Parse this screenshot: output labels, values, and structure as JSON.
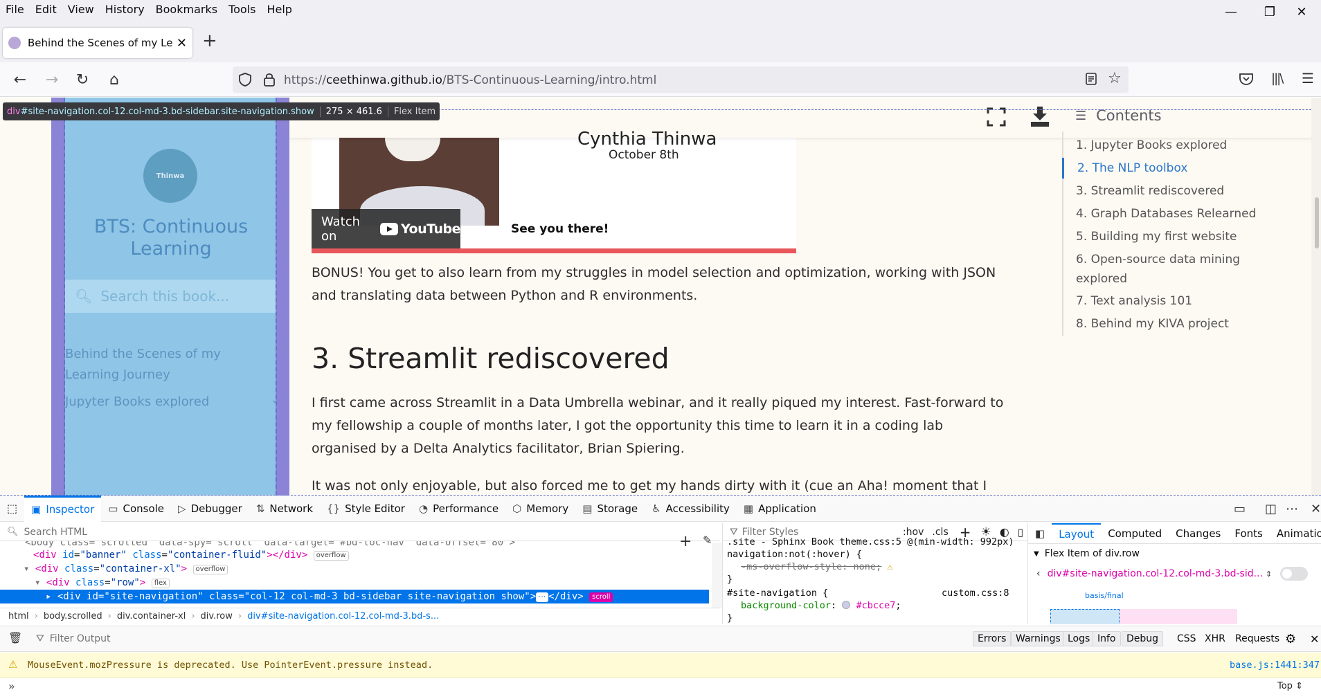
{
  "menubar": [
    "File",
    "Edit",
    "View",
    "History",
    "Bookmarks",
    "Tools",
    "Help"
  ],
  "tab": {
    "title": "Behind the Scenes of my Learning Journey"
  },
  "url": {
    "prefix": "https://",
    "host": "ceethinwa.github.io",
    "path": "/BTS-Continuous-Learning/intro.html"
  },
  "tooltip": {
    "tag": "div",
    "selector": "#site-navigation.col-12.col-md-3.bd-sidebar.site-navigation.show",
    "dimensions": "275 × 461.6",
    "kind": "Flex Item"
  },
  "sidebar": {
    "logo_text": "Thinwa",
    "title": "BTS: Continuous Learning",
    "search_placeholder": "Search this book...",
    "links": [
      "Behind the Scenes of my Learning Journey",
      "Jupyter Books explored"
    ]
  },
  "video": {
    "name": "Cynthia Thinwa",
    "date": "October 8th",
    "see_you": "See you there!",
    "watch_on": "Watch on",
    "youtube": "YouTube"
  },
  "article": {
    "bonus": "BONUS! You get to also learn from my struggles in model selection and optimization, working with JSON and translating data between Python and R environments.",
    "heading": "3. Streamlit rediscovered",
    "p1": "I first came across Streamlit in a Data Umbrella webinar, and it really piqued my interest. Fast-forward to my fellowship a couple of months later, I got the opportunity this time to learn it in a coding lab organised by a Delta Analytics facilitator, Brian Spiering.",
    "p2": "It was not only enjoyable, but also forced me to get my hands dirty with it (cue an Aha! moment that I"
  },
  "toc": {
    "title": "Contents",
    "items": [
      "1. Jupyter Books explored",
      "2. The NLP toolbox",
      "3. Streamlit rediscovered",
      "4. Graph Databases Relearned",
      "5. Building my first website",
      "6. Open-source data mining explored",
      "7. Text analysis 101",
      "8. Behind my KIVA project"
    ],
    "active_index": 1
  },
  "devtools": {
    "tabs": [
      "Inspector",
      "Console",
      "Debugger",
      "Network",
      "Style Editor",
      "Performance",
      "Memory",
      "Storage",
      "Accessibility",
      "Application"
    ],
    "active_tab": "Inspector",
    "search_html_placeholder": "Search HTML",
    "markup": {
      "line0": "<body class=\"scrolled\" data-spy=\"scroll\" data-target=\"#bd-toc-nav\" data-offset=\"80\">",
      "banner": {
        "tag": "div",
        "id": "banner",
        "class": "container-fluid",
        "badge": "overflow"
      },
      "container": {
        "tag": "div",
        "class": "container-xl",
        "badge": "overflow"
      },
      "row": {
        "tag": "div",
        "class": "row",
        "badge": "flex"
      },
      "selected": {
        "tag": "div",
        "id": "site-navigation",
        "class": "col-12 col-md-3 bd-sidebar site-navigation show",
        "badge": "scroll"
      }
    },
    "breadcrumbs": [
      "html",
      "body.scrolled",
      "div.container-xl",
      "div.row",
      "div#site-navigation.col-12.col-md-3.bd-s..."
    ],
    "styles": {
      "filter_placeholder": "Filter Styles",
      "hov": ":hov",
      "cls": ".cls",
      "rule1_sel_a": ".site - Sphinx Book theme.css:5 @(min-width: 992px)",
      "rule1_sel_b": "navigation:not(:hover) {",
      "rule1_prop": "-ms-overflow-style: none;",
      "rule2_sel": "#site-navigation {",
      "rule2_src": "custom.css:8",
      "rule2_prop": "background-color",
      "rule2_val": "#cbcce7",
      "close": "}"
    },
    "layout_tabs": [
      "Layout",
      "Computed",
      "Changes",
      "Fonts",
      "Animations"
    ],
    "flex_item_of": "Flex Item of div.row",
    "flex_selector": "div#site-navigation.col-12.col-md-3.bd-sid...",
    "basis_label": "basis/final",
    "console": {
      "filter_placeholder": "Filter Output",
      "filters": [
        "Errors",
        "Warnings",
        "Logs",
        "Info",
        "Debug"
      ],
      "extra_filters": [
        "CSS",
        "XHR",
        "Requests"
      ],
      "warning": "MouseEvent.mozPressure is deprecated. Use PointerEvent.pressure instead.",
      "warning_source": "base.js:1441:347",
      "context": "Top"
    }
  },
  "colors": {
    "accent": "#0074e8",
    "sidebar": "#8fc5e6",
    "toc_active": "#2a76c9",
    "video_bar": "#e8575c"
  }
}
